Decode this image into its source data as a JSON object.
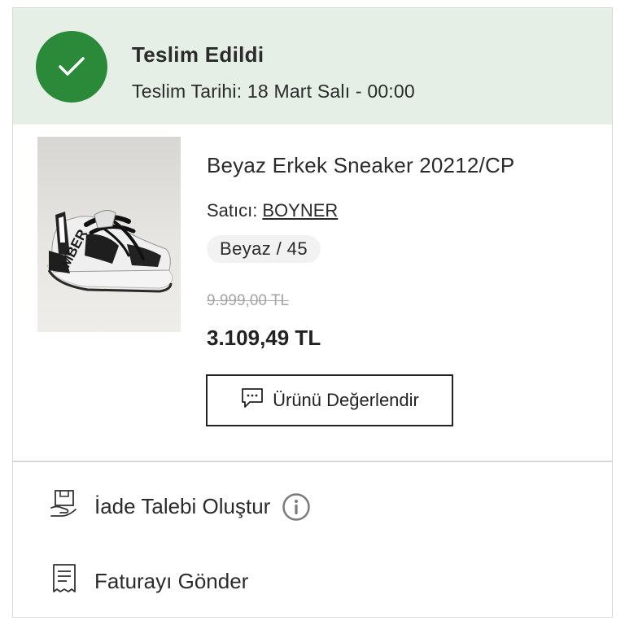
{
  "status": {
    "title": "Teslim Edildi",
    "date_text": "Teslim Tarihi: 18 Mart Salı - 00:00",
    "color": "#2a8a3a",
    "background": "#e5efe6"
  },
  "product": {
    "name": "Beyaz Erkek Sneaker 20212/CP",
    "seller_label": "Satıcı:",
    "seller_name": "BOYNER",
    "variant": "Beyaz / 45",
    "old_price": "9.999,00 TL",
    "price": "3.109,49 TL",
    "review_button_label": "Ürünü Değerlendir",
    "image_brand_text": "MBER"
  },
  "actions": {
    "return_label": "İade Talebi Oluştur",
    "invoice_label": "Faturayı Gönder"
  },
  "icons": {
    "status": "check-icon",
    "review": "chat-bubble-icon",
    "return": "return-box-icon",
    "return_info": "info-icon",
    "invoice": "receipt-icon"
  }
}
